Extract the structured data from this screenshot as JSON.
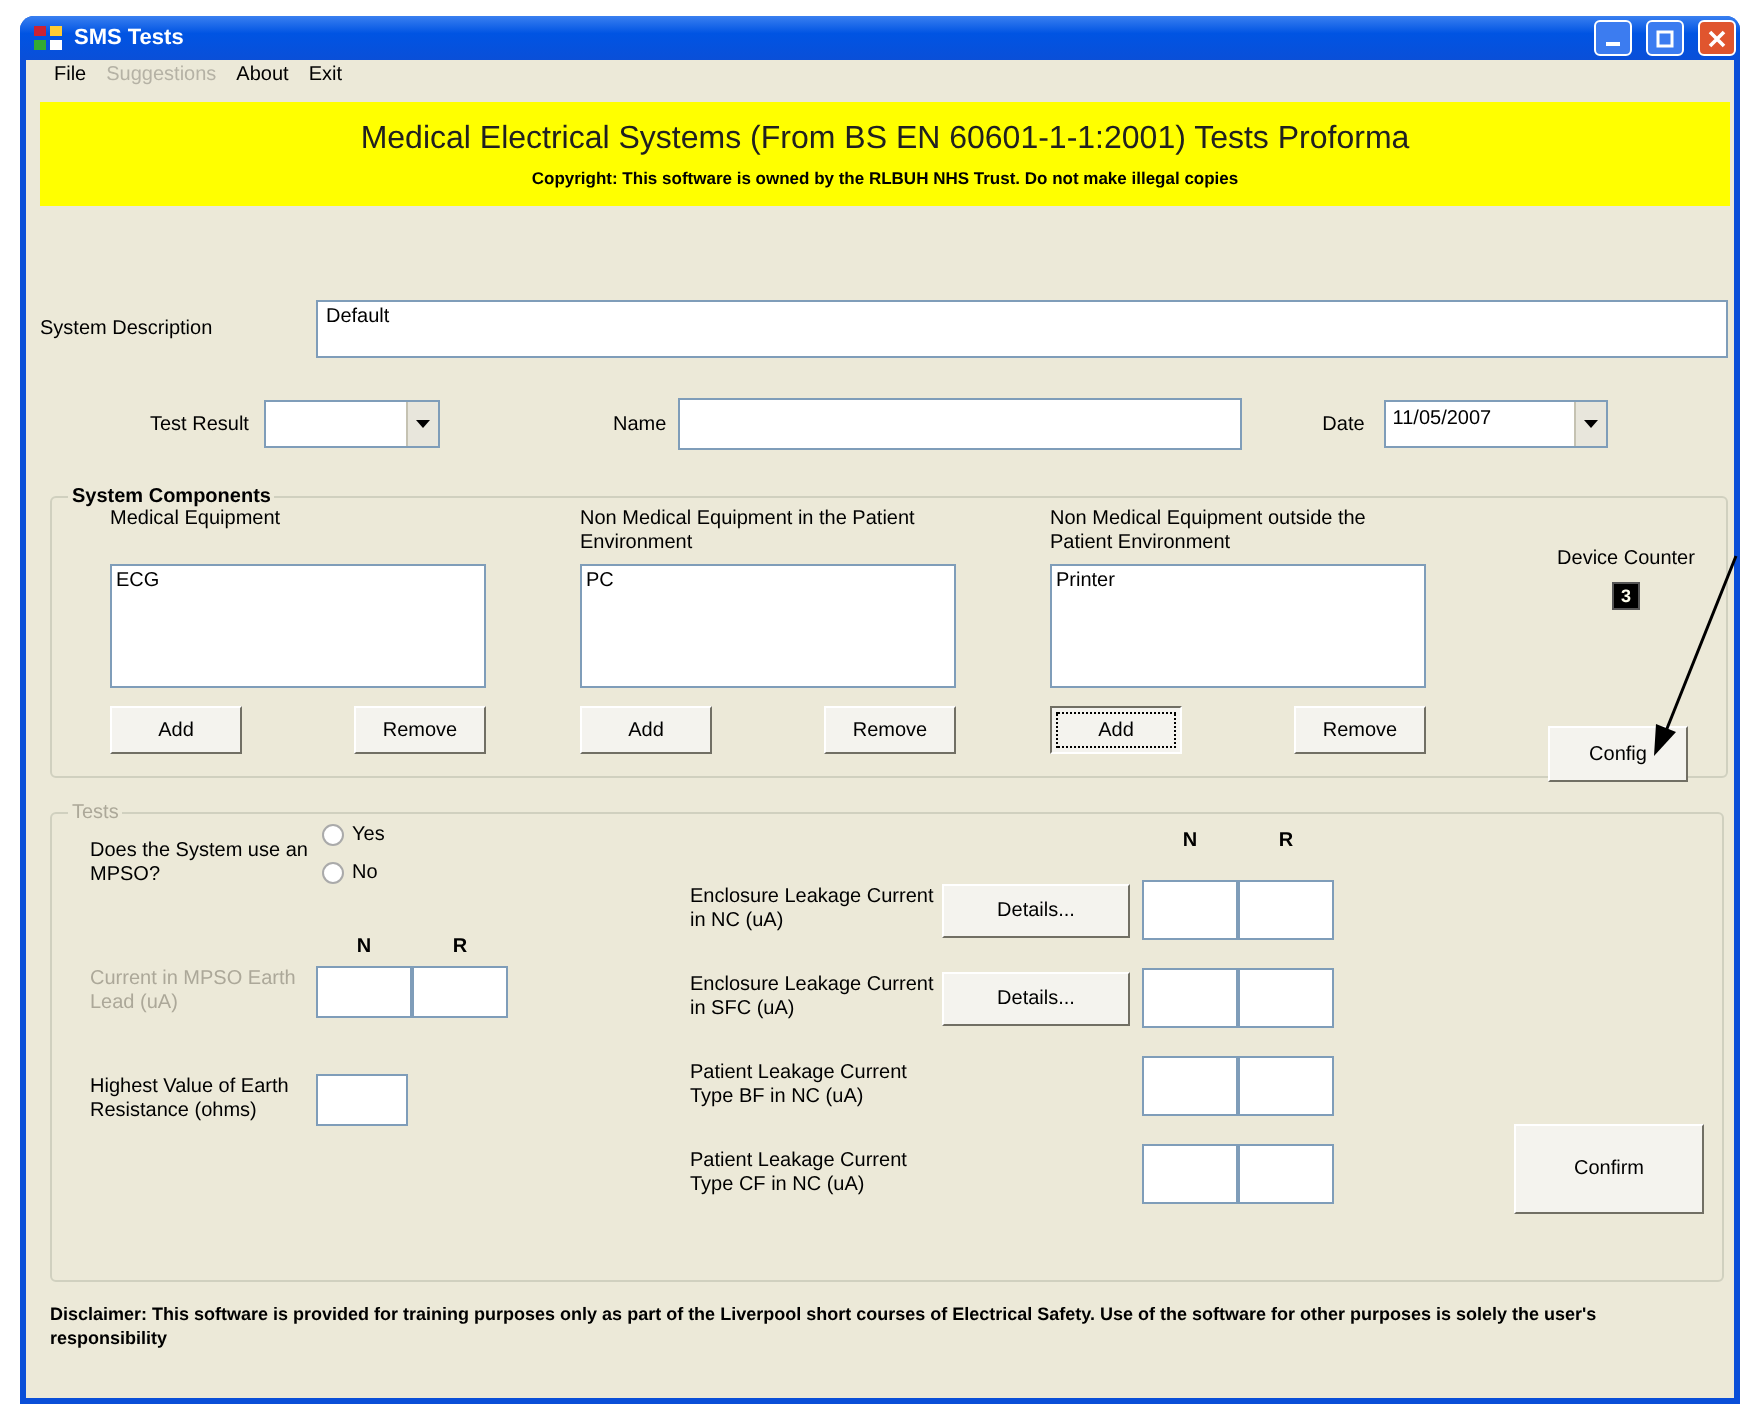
{
  "window": {
    "title": "SMS Tests"
  },
  "menu": [
    {
      "label": "File",
      "disabled": false
    },
    {
      "label": "Suggestions",
      "disabled": true
    },
    {
      "label": "About",
      "disabled": false
    },
    {
      "label": "Exit",
      "disabled": false
    }
  ],
  "banner": {
    "title": "Medical Electrical Systems (From BS EN 60601-1-1:2001) Tests Proforma",
    "copyright": "Copyright: This software is owned by the RLBUH NHS Trust. Do not make illegal copies"
  },
  "system_description": {
    "label": "System Description",
    "value": "Default"
  },
  "test_result": {
    "label": "Test Result"
  },
  "name": {
    "label": "Name"
  },
  "date": {
    "label": "Date",
    "value": "11/05/2007"
  },
  "system_components": {
    "title": "System Components",
    "lists": [
      {
        "label": "Medical Equipment",
        "items": [
          "ECG"
        ],
        "buttons": [
          {
            "label": "Add",
            "focused": false
          },
          {
            "label": "Remove",
            "focused": false
          }
        ]
      },
      {
        "label": "Non Medical Equipment in the Patient Environment",
        "items": [
          "PC"
        ],
        "buttons": [
          {
            "label": "Add",
            "focused": false
          },
          {
            "label": "Remove",
            "focused": false
          }
        ]
      },
      {
        "label": "Non Medical Equipment outside the Patient Environment",
        "items": [
          "Printer"
        ],
        "buttons": [
          {
            "label": "Add",
            "focused": true
          },
          {
            "label": "Remove",
            "focused": false
          }
        ]
      }
    ],
    "device_counter": {
      "label": "Device Counter",
      "value": "3"
    },
    "config_button": "Config"
  },
  "tests": {
    "title": "Tests",
    "disabled": true,
    "mpso": {
      "question": "Does the System use an MPSO?",
      "options": [
        {
          "label": "Yes",
          "selected": false
        },
        {
          "label": "No",
          "selected": false
        }
      ]
    },
    "earth_lead": {
      "label": "Current in MPSO Earth Lead (uA)",
      "disabled": true,
      "columns": [
        "N",
        "R"
      ]
    },
    "earth_resistance": {
      "label": "Highest Value of Earth Resistance (ohms)"
    },
    "leakage_columns": [
      "N",
      "R"
    ],
    "leakage": [
      {
        "label": "Enclosure Leakage Current in NC (uA)",
        "details": "Details..."
      },
      {
        "label": "Enclosure Leakage Current in SFC (uA)",
        "details": "Details..."
      },
      {
        "label": "Patient Leakage Current Type BF in NC (uA)"
      },
      {
        "label": "Patient Leakage Current Type CF in NC (uA)"
      }
    ],
    "confirm": "Confirm"
  },
  "disclaimer": "Disclaimer: This software is provided for training purposes only as part of the Liverpool short courses of Electrical Safety. Use of the software for other purposes is solely the user's responsibility"
}
